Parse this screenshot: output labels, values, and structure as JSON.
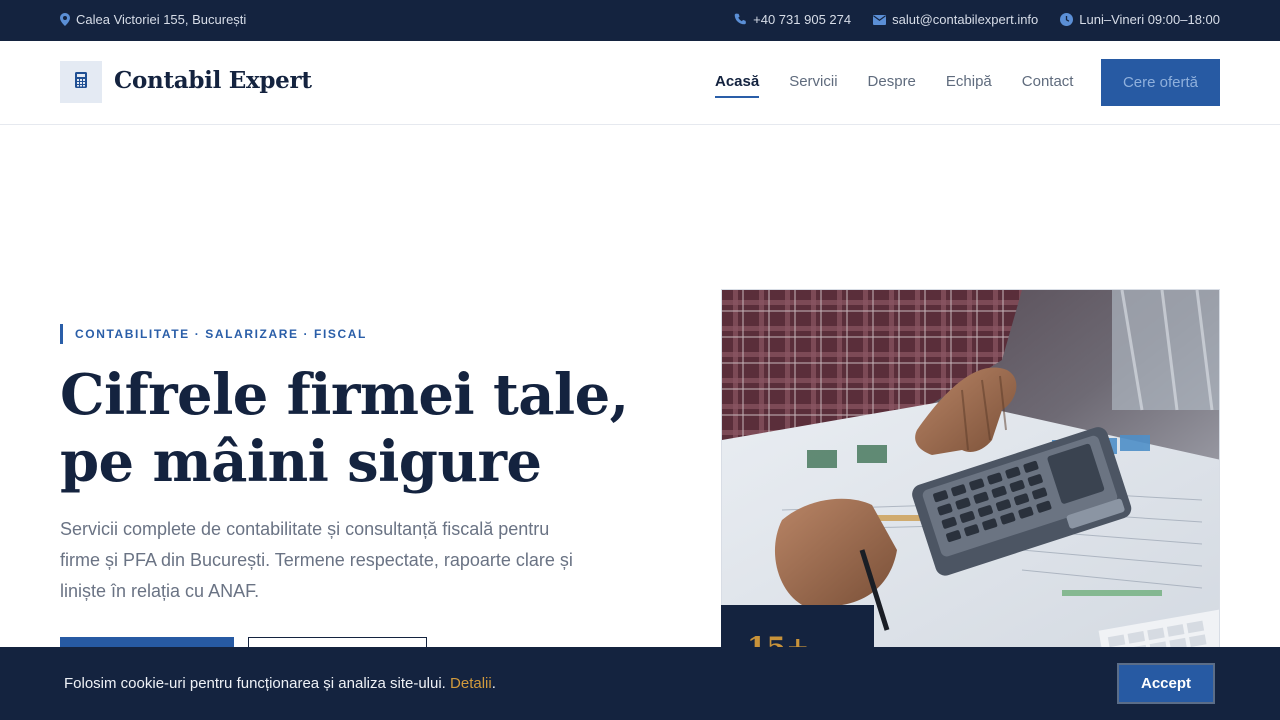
{
  "topbar": {
    "address": "Calea Victoriei 155, București",
    "phone": "+40 731 905 274",
    "email": "salut@contabilexpert.info",
    "hours": "Luni–Vineri 09:00–18:00",
    "icons": [
      "map-pin-icon",
      "phone-icon",
      "envelope-icon",
      "clock-icon"
    ]
  },
  "header": {
    "logo_text": "Contabil Expert",
    "logo_icon": "calculator-icon",
    "nav": [
      {
        "label": "Acasă",
        "active": true
      },
      {
        "label": "Servicii",
        "active": false
      },
      {
        "label": "Despre",
        "active": false
      },
      {
        "label": "Echipă",
        "active": false
      },
      {
        "label": "Contact",
        "active": false
      }
    ],
    "cta_label": "Cere ofertă"
  },
  "hero": {
    "eyebrow": "CONTABILITATE · SALARIZARE · FISCAL",
    "title": "Cifrele firmei tale, pe mâini sigure",
    "lead": "Servicii complete de contabilitate și consultanță fiscală pentru firme și PFA din București. Termene respectate, rapoarte clare și liniște în relația cu ANAF.",
    "stat_partial": "15+"
  },
  "cookie": {
    "text": "Folosim cookie-uri pentru funcționarea și analiza site-ului.",
    "link": "Detalii",
    "suffix": ".",
    "accept_label": "Accept"
  },
  "colors": {
    "navy": "#14233f",
    "accent_blue": "#275aa3",
    "gold": "#c9933a"
  }
}
